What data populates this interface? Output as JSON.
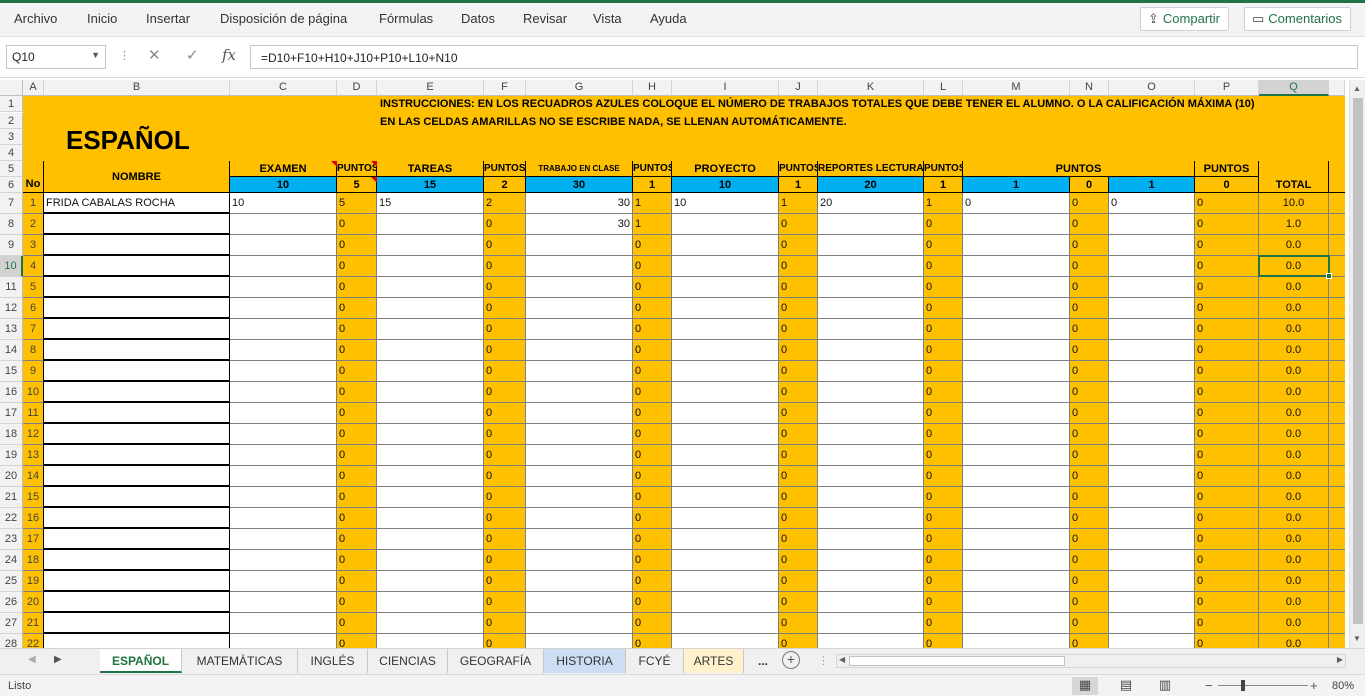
{
  "ribbon": {
    "menu": [
      "Archivo",
      "Inicio",
      "Insertar",
      "Disposición de página",
      "Fórmulas",
      "Datos",
      "Revisar",
      "Vista",
      "Ayuda"
    ],
    "share_label": "Compartir",
    "comments_label": "Comentarios"
  },
  "formula_bar": {
    "name_box": "Q10",
    "formula": "=D10+F10+H10+J10+P10+L10+N10",
    "cancel_glyph": "✕",
    "confirm_glyph": "✓",
    "fx_glyph": "fx"
  },
  "columns": [
    "A",
    "B",
    "C",
    "D",
    "E",
    "F",
    "G",
    "H",
    "I",
    "J",
    "K",
    "L",
    "M",
    "N",
    "O",
    "P",
    "Q"
  ],
  "selected_cell": "Q10",
  "sheet": {
    "title": "ESPAÑOL",
    "instruction_1": "INSTRUCCIONES: EN LOS RECUADROS AZULES COLOQUE EL NÚMERO DE TRABAJOS TOTALES QUE DEBE TENER EL ALUMNO. O LA CALIFICACIÓN MÁXIMA (10)",
    "instruction_2": "EN LAS CELDAS AMARILLAS NO SE ESCRIBE NADA, SE LLENAN AUTOMÁTICAMENTE.",
    "headers": {
      "no": "No",
      "nombre": "NOMBRE",
      "examen": "EXAMEN",
      "puntos": "PUNTOS",
      "tareas": "TAREAS",
      "trabajo": "TRABAJO EN CLASE",
      "proyecto": "PROYECTO",
      "reportes": "REPORTES LECTURA",
      "total": "TOTAL"
    },
    "max_values": {
      "examen": "10",
      "d": "5",
      "tareas": "15",
      "f": "2",
      "trabajo": "30",
      "h": "1",
      "proyecto": "10",
      "j": "1",
      "reportes": "20",
      "l": "1",
      "m": "1",
      "n": "0",
      "o": "1",
      "p": "0"
    },
    "rows": [
      {
        "row": "7",
        "no": "1",
        "name": "FRIDA CABALAS ROCHA",
        "c": "10",
        "d": "5",
        "e": "15",
        "f": "2",
        "g": "30",
        "h": "1",
        "i": "10",
        "j": "1",
        "k": "20",
        "l": "1",
        "m": "0",
        "n": "0",
        "o": "0",
        "p": "0",
        "q": "10.0"
      },
      {
        "row": "8",
        "no": "2",
        "name": "",
        "c": "",
        "d": "0",
        "e": "",
        "f": "0",
        "g": "30",
        "h": "1",
        "i": "",
        "j": "0",
        "k": "",
        "l": "0",
        "m": "",
        "n": "0",
        "o": "",
        "p": "0",
        "q": "1.0"
      },
      {
        "row": "9",
        "no": "3",
        "name": "",
        "c": "",
        "d": "0",
        "e": "",
        "f": "0",
        "g": "",
        "h": "0",
        "i": "",
        "j": "0",
        "k": "",
        "l": "0",
        "m": "",
        "n": "0",
        "o": "",
        "p": "0",
        "q": "0.0"
      },
      {
        "row": "10",
        "no": "4",
        "name": "",
        "c": "",
        "d": "0",
        "e": "",
        "f": "0",
        "g": "",
        "h": "0",
        "i": "",
        "j": "0",
        "k": "",
        "l": "0",
        "m": "",
        "n": "0",
        "o": "",
        "p": "0",
        "q": "0.0"
      },
      {
        "row": "11",
        "no": "5",
        "name": "",
        "c": "",
        "d": "0",
        "e": "",
        "f": "0",
        "g": "",
        "h": "0",
        "i": "",
        "j": "0",
        "k": "",
        "l": "0",
        "m": "",
        "n": "0",
        "o": "",
        "p": "0",
        "q": "0.0"
      },
      {
        "row": "12",
        "no": "6",
        "name": "",
        "c": "",
        "d": "0",
        "e": "",
        "f": "0",
        "g": "",
        "h": "0",
        "i": "",
        "j": "0",
        "k": "",
        "l": "0",
        "m": "",
        "n": "0",
        "o": "",
        "p": "0",
        "q": "0.0"
      },
      {
        "row": "13",
        "no": "7",
        "name": "",
        "c": "",
        "d": "0",
        "e": "",
        "f": "0",
        "g": "",
        "h": "0",
        "i": "",
        "j": "0",
        "k": "",
        "l": "0",
        "m": "",
        "n": "0",
        "o": "",
        "p": "0",
        "q": "0.0"
      },
      {
        "row": "14",
        "no": "8",
        "name": "",
        "c": "",
        "d": "0",
        "e": "",
        "f": "0",
        "g": "",
        "h": "0",
        "i": "",
        "j": "0",
        "k": "",
        "l": "0",
        "m": "",
        "n": "0",
        "o": "",
        "p": "0",
        "q": "0.0"
      },
      {
        "row": "15",
        "no": "9",
        "name": "",
        "c": "",
        "d": "0",
        "e": "",
        "f": "0",
        "g": "",
        "h": "0",
        "i": "",
        "j": "0",
        "k": "",
        "l": "0",
        "m": "",
        "n": "0",
        "o": "",
        "p": "0",
        "q": "0.0"
      },
      {
        "row": "16",
        "no": "10",
        "name": "",
        "c": "",
        "d": "0",
        "e": "",
        "f": "0",
        "g": "",
        "h": "0",
        "i": "",
        "j": "0",
        "k": "",
        "l": "0",
        "m": "",
        "n": "0",
        "o": "",
        "p": "0",
        "q": "0.0"
      },
      {
        "row": "17",
        "no": "11",
        "name": "",
        "c": "",
        "d": "0",
        "e": "",
        "f": "0",
        "g": "",
        "h": "0",
        "i": "",
        "j": "0",
        "k": "",
        "l": "0",
        "m": "",
        "n": "0",
        "o": "",
        "p": "0",
        "q": "0.0"
      },
      {
        "row": "18",
        "no": "12",
        "name": "",
        "c": "",
        "d": "0",
        "e": "",
        "f": "0",
        "g": "",
        "h": "0",
        "i": "",
        "j": "0",
        "k": "",
        "l": "0",
        "m": "",
        "n": "0",
        "o": "",
        "p": "0",
        "q": "0.0"
      },
      {
        "row": "19",
        "no": "13",
        "name": "",
        "c": "",
        "d": "0",
        "e": "",
        "f": "0",
        "g": "",
        "h": "0",
        "i": "",
        "j": "0",
        "k": "",
        "l": "0",
        "m": "",
        "n": "0",
        "o": "",
        "p": "0",
        "q": "0.0"
      },
      {
        "row": "20",
        "no": "14",
        "name": "",
        "c": "",
        "d": "0",
        "e": "",
        "f": "0",
        "g": "",
        "h": "0",
        "i": "",
        "j": "0",
        "k": "",
        "l": "0",
        "m": "",
        "n": "0",
        "o": "",
        "p": "0",
        "q": "0.0"
      },
      {
        "row": "21",
        "no": "15",
        "name": "",
        "c": "",
        "d": "0",
        "e": "",
        "f": "0",
        "g": "",
        "h": "0",
        "i": "",
        "j": "0",
        "k": "",
        "l": "0",
        "m": "",
        "n": "0",
        "o": "",
        "p": "0",
        "q": "0.0"
      },
      {
        "row": "22",
        "no": "16",
        "name": "",
        "c": "",
        "d": "0",
        "e": "",
        "f": "0",
        "g": "",
        "h": "0",
        "i": "",
        "j": "0",
        "k": "",
        "l": "0",
        "m": "",
        "n": "0",
        "o": "",
        "p": "0",
        "q": "0.0"
      },
      {
        "row": "23",
        "no": "17",
        "name": "",
        "c": "",
        "d": "0",
        "e": "",
        "f": "0",
        "g": "",
        "h": "0",
        "i": "",
        "j": "0",
        "k": "",
        "l": "0",
        "m": "",
        "n": "0",
        "o": "",
        "p": "0",
        "q": "0.0"
      },
      {
        "row": "24",
        "no": "18",
        "name": "",
        "c": "",
        "d": "0",
        "e": "",
        "f": "0",
        "g": "",
        "h": "0",
        "i": "",
        "j": "0",
        "k": "",
        "l": "0",
        "m": "",
        "n": "0",
        "o": "",
        "p": "0",
        "q": "0.0"
      },
      {
        "row": "25",
        "no": "19",
        "name": "",
        "c": "",
        "d": "0",
        "e": "",
        "f": "0",
        "g": "",
        "h": "0",
        "i": "",
        "j": "0",
        "k": "",
        "l": "0",
        "m": "",
        "n": "0",
        "o": "",
        "p": "0",
        "q": "0.0"
      },
      {
        "row": "26",
        "no": "20",
        "name": "",
        "c": "",
        "d": "0",
        "e": "",
        "f": "0",
        "g": "",
        "h": "0",
        "i": "",
        "j": "0",
        "k": "",
        "l": "0",
        "m": "",
        "n": "0",
        "o": "",
        "p": "0",
        "q": "0.0"
      },
      {
        "row": "27",
        "no": "21",
        "name": "",
        "c": "",
        "d": "0",
        "e": "",
        "f": "0",
        "g": "",
        "h": "0",
        "i": "",
        "j": "0",
        "k": "",
        "l": "0",
        "m": "",
        "n": "0",
        "o": "",
        "p": "0",
        "q": "0.0"
      },
      {
        "row": "28",
        "no": "22",
        "name": "",
        "c": "",
        "d": "0",
        "e": "",
        "f": "0",
        "g": "",
        "h": "0",
        "i": "",
        "j": "0",
        "k": "",
        "l": "0",
        "m": "",
        "n": "0",
        "o": "",
        "p": "0",
        "q": "0.0"
      }
    ]
  },
  "tabs": [
    "ESPAÑOL",
    "MATEMÀTICAS",
    "INGLÉS",
    "CIENCIAS",
    "GEOGRAFÍA",
    "HISTORIA",
    "FCYÉ",
    "ARTES",
    "..."
  ],
  "status": {
    "ready": "Listo",
    "zoom": "80%",
    "zoom_level_percent": 80
  },
  "colors": {
    "accent": "#217346",
    "auto_cells": "#ffc000",
    "input_cells": "#00b0f0"
  }
}
